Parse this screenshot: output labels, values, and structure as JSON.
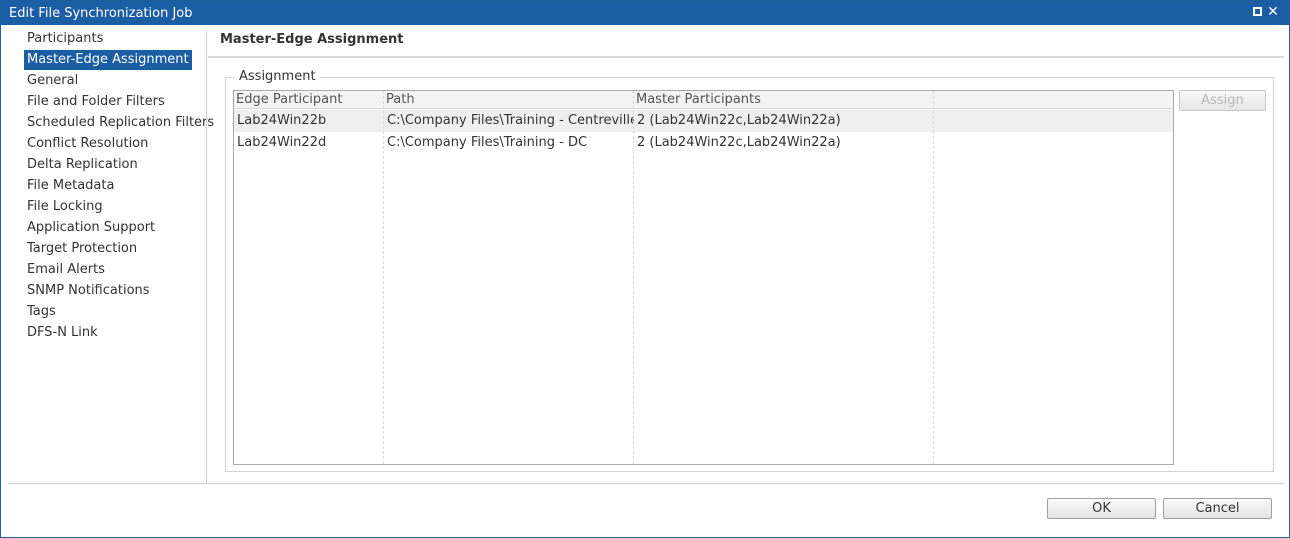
{
  "window": {
    "title": "Edit File Synchronization Job",
    "maximize_icon": "maximize-icon",
    "close_icon": "close-icon",
    "close_glyph": "✕"
  },
  "sidebar": {
    "items": [
      {
        "label": "Participants"
      },
      {
        "label": "Master-Edge Assignment",
        "selected": true
      },
      {
        "label": "General"
      },
      {
        "label": "File and Folder Filters"
      },
      {
        "label": "Scheduled Replication Filters"
      },
      {
        "label": "Conflict Resolution"
      },
      {
        "label": "Delta Replication"
      },
      {
        "label": "File Metadata"
      },
      {
        "label": "File Locking"
      },
      {
        "label": "Application Support"
      },
      {
        "label": "Target Protection"
      },
      {
        "label": "Email Alerts"
      },
      {
        "label": "SNMP Notifications"
      },
      {
        "label": "Tags"
      },
      {
        "label": "DFS-N Link"
      }
    ]
  },
  "main": {
    "title": "Master-Edge Assignment",
    "group_label": "Assignment",
    "assign_label": "Assign",
    "table": {
      "columns": [
        "Edge Participant",
        "Path",
        "Master Participants",
        ""
      ],
      "rows": [
        [
          "Lab24Win22b",
          "C:\\Company Files\\Training - Centreville",
          "2 (Lab24Win22c,Lab24Win22a)"
        ],
        [
          "Lab24Win22d",
          "C:\\Company Files\\Training - DC",
          "2 (Lab24Win22c,Lab24Win22a)"
        ]
      ]
    }
  },
  "footer": {
    "ok_label": "OK",
    "cancel_label": "Cancel"
  },
  "colors": {
    "accent": "#1b5ea4",
    "selected_row": "#efefef"
  }
}
